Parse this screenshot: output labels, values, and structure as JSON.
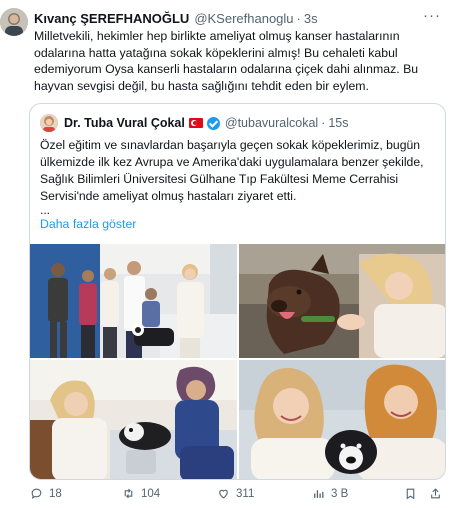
{
  "tweet": {
    "author_name": "Kıvanç ŞEREFHANOĞLU",
    "handle": "@KSerefhanoglu",
    "separator": "·",
    "time": "3s",
    "more": "···",
    "text": "Milletvekili, hekimler hep birlikte ameliyat olmuş kanser hastalarının odalarına hatta yatağına sokak köpeklerini almış! Bu cehaleti kabul edemiyorum Oysa kanserli hastaların odalarına çiçek dahi alınmaz. Bu hayvan sevgisi değil, bu hasta sağlığını tehdit eden bir eylem."
  },
  "quote": {
    "author_name": "Dr. Tuba Vural Çokal",
    "handle": "@tubavuralcokal",
    "separator": "·",
    "time": "15s",
    "text": "Özel eğitim ve sınavlardan başarıyla geçen sokak köpeklerimiz, bugün ülkemizde ilk kez Avrupa ve Amerika'daki uygulamalara benzer şekilde, Sağlık Bilimleri Üniversitesi Gülhane Tıp Fakültesi Meme Cerrahisi Servisi'nde ameliyat olmuş hastaları ziyaret etti.",
    "ellipsis": "...",
    "show_more": "Daha fazla göster"
  },
  "actions": {
    "replies": "18",
    "retweets": "104",
    "likes": "311",
    "views": "3 B"
  },
  "colors": {
    "link": "#1d9bf0",
    "text": "#0f1419",
    "muted": "#536471",
    "border": "#cfd9de"
  }
}
